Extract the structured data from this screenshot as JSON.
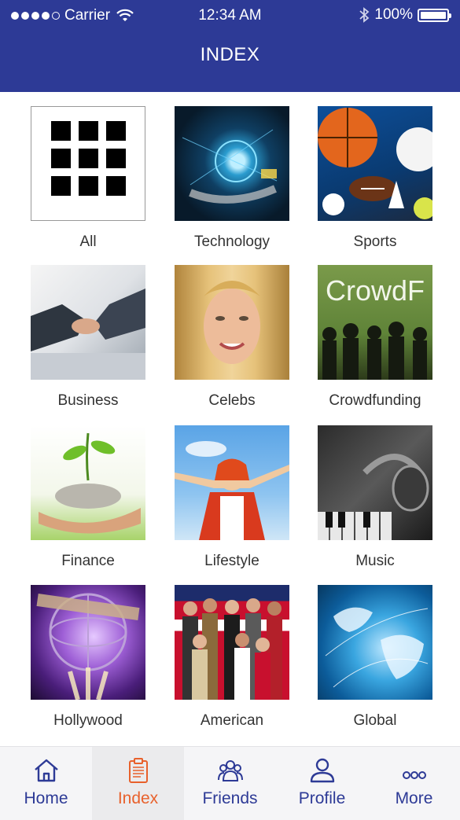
{
  "status_bar": {
    "carrier": "Carrier",
    "time": "12:34 AM",
    "battery": "100%"
  },
  "header": {
    "title": "INDEX"
  },
  "categories": [
    {
      "label": "All",
      "thumb": "grid-icon"
    },
    {
      "label": "Technology",
      "thumb": "technology-image"
    },
    {
      "label": "Sports",
      "thumb": "sports-image"
    },
    {
      "label": "Business",
      "thumb": "business-image"
    },
    {
      "label": "Celebs",
      "thumb": "celebs-image"
    },
    {
      "label": "Crowdfunding",
      "thumb": "crowdfunding-image",
      "overlay_text": "CrowdF"
    },
    {
      "label": "Finance",
      "thumb": "finance-image"
    },
    {
      "label": "Lifestyle",
      "thumb": "lifestyle-image"
    },
    {
      "label": "Music",
      "thumb": "music-image"
    },
    {
      "label": "Hollywood",
      "thumb": "hollywood-image"
    },
    {
      "label": "American",
      "thumb": "american-image"
    },
    {
      "label": "Global",
      "thumb": "global-image"
    }
  ],
  "tabbar": {
    "items": [
      {
        "label": "Home",
        "icon": "home-icon"
      },
      {
        "label": "Index",
        "icon": "clipboard-icon",
        "active": true
      },
      {
        "label": "Friends",
        "icon": "friends-icon"
      },
      {
        "label": "Profile",
        "icon": "profile-icon"
      },
      {
        "label": "More",
        "icon": "more-icon"
      }
    ]
  },
  "colors": {
    "header_bg": "#2d3a96",
    "tab_inactive": "#2d3a96",
    "tab_active": "#e8612c"
  }
}
